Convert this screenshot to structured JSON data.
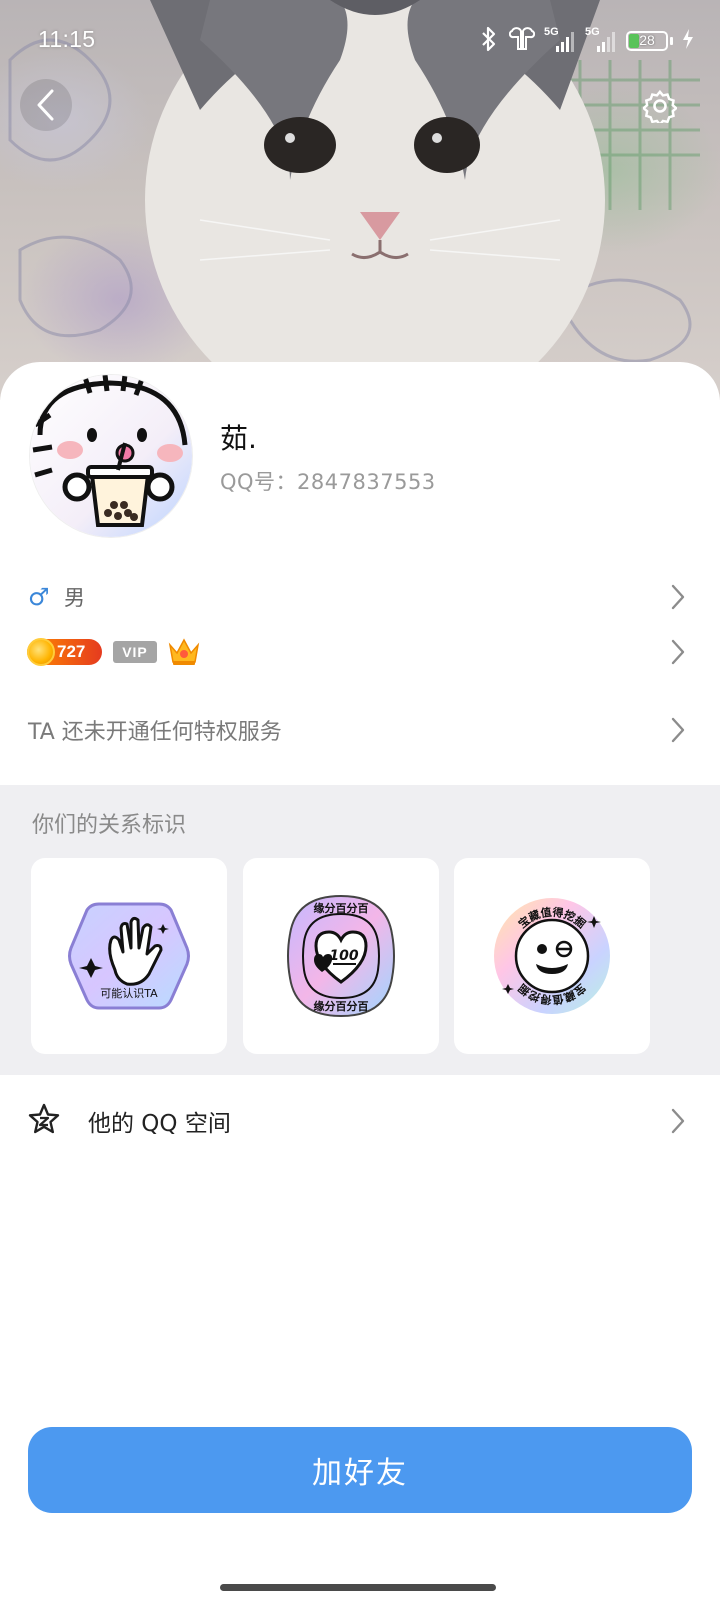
{
  "status_bar": {
    "time": "11:15",
    "signal_1": "5G",
    "signal_2": "5G",
    "battery_level": "28",
    "battery_fraction": 0.28,
    "icons": [
      "bluetooth-icon",
      "earbuds-icon",
      "signal-icon",
      "signal-icon",
      "battery-icon",
      "charging-icon"
    ]
  },
  "header": {
    "back_icon": "chevron-left-icon",
    "settings_icon": "gear-icon"
  },
  "profile": {
    "nickname": "茹.",
    "qq_number": "QQ号：2847837553",
    "gender_symbol": "♂",
    "gender": "男",
    "level": "727",
    "vip": "VIP",
    "privilege_text": "TA 还未开通任何特权服务"
  },
  "relationship": {
    "title": "你们的关系标识",
    "badges": [
      {
        "name": "可能认识TA",
        "icon": "hand-wave-icon"
      },
      {
        "name": "缘分百分百",
        "icon": "heart-100-icon"
      },
      {
        "name": "宝藏值得挖掘",
        "icon": "smiley-face-icon"
      }
    ]
  },
  "qzone": {
    "label": "他的 QQ 空间",
    "icon": "star-icon"
  },
  "actions": {
    "add_friend": "加好友"
  },
  "colors": {
    "primary_blue": "#4c99f0",
    "gender_blue": "#3b87d9",
    "section_bg": "#efeff2"
  }
}
